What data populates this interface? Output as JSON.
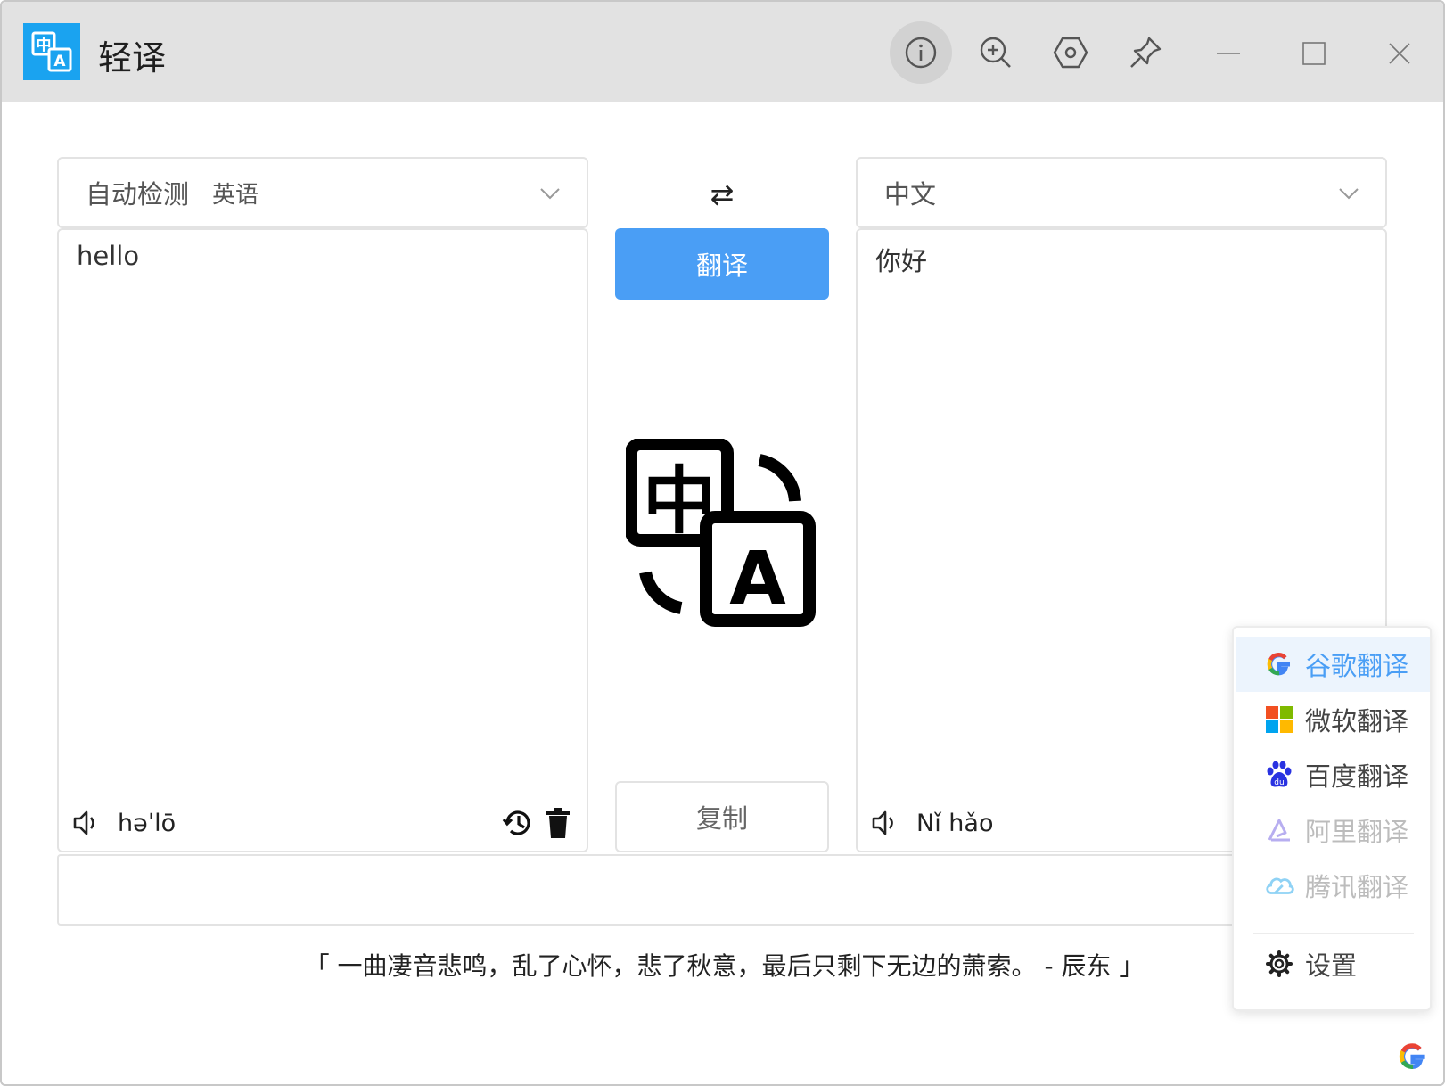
{
  "window": {
    "title": "轻译",
    "toolbar": [
      {
        "name": "info-icon",
        "label": "info"
      },
      {
        "name": "zoom-in-icon",
        "label": "zoom"
      },
      {
        "name": "settings-hex-icon",
        "label": "settings"
      },
      {
        "name": "pin-icon",
        "label": "pin"
      }
    ],
    "controls": [
      "minimize",
      "maximize",
      "close"
    ]
  },
  "source": {
    "language_label": "自动检测",
    "detected_language": "英语",
    "text": "hello",
    "phonetic": "həˈlō"
  },
  "target": {
    "language_label": "中文",
    "text": "你好",
    "phonetic": "Nǐ hǎo"
  },
  "center": {
    "swap_glyph": "⇄",
    "translate_label": "翻译",
    "copy_label": "复制"
  },
  "quote": "「 一曲凄音悲鸣，乱了心怀，悲了秋意，最后只剩下无边的萧索。 - 辰东 」",
  "engines": [
    {
      "label": "谷歌翻译",
      "icon": "google-icon",
      "state": "selected"
    },
    {
      "label": "微软翻译",
      "icon": "microsoft-icon",
      "state": "normal"
    },
    {
      "label": "百度翻译",
      "icon": "baidu-icon",
      "state": "normal"
    },
    {
      "label": "阿里翻译",
      "icon": "alibaba-icon",
      "state": "disabled"
    },
    {
      "label": "腾讯翻译",
      "icon": "tencent-cloud-icon",
      "state": "disabled"
    }
  ],
  "settings_label": "设置",
  "colors": {
    "accent": "#4a9ef5",
    "app_logo": "#1aa3f0",
    "titlebar": "#e2e2e2"
  }
}
